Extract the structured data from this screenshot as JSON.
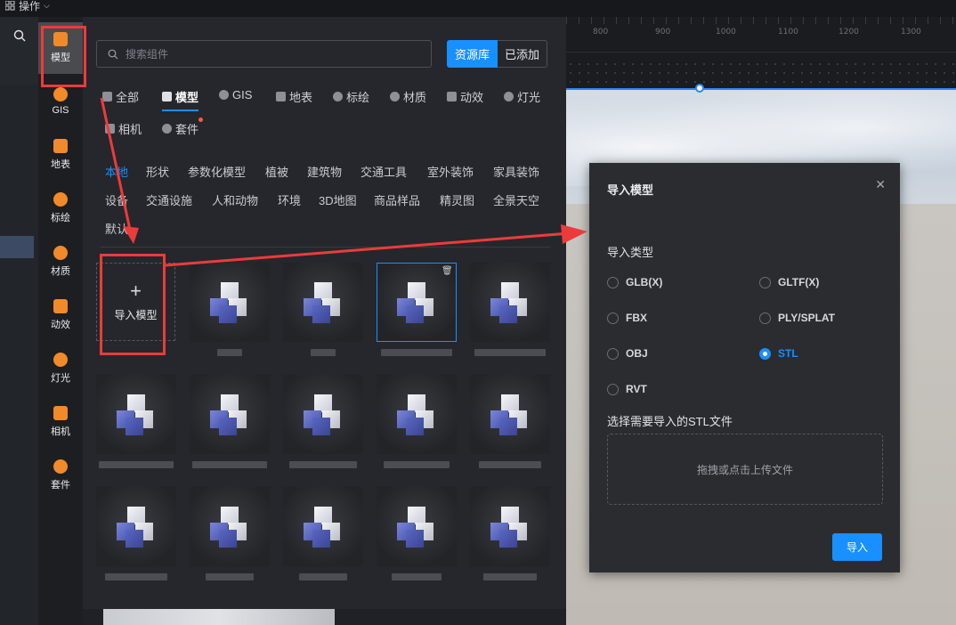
{
  "topbar": {
    "menu_label": "操作"
  },
  "ruler": {
    "ticks": [
      "800",
      "900",
      "1000",
      "1100",
      "1200",
      "1300"
    ]
  },
  "nav": {
    "items": [
      {
        "label": "模型",
        "icon": "model-icon"
      },
      {
        "label": "GIS",
        "icon": "gis-icon"
      },
      {
        "label": "地表",
        "icon": "terrain-icon"
      },
      {
        "label": "标绘",
        "icon": "pin-icon"
      },
      {
        "label": "材质",
        "icon": "material-icon"
      },
      {
        "label": "动效",
        "icon": "effect-icon"
      },
      {
        "label": "灯光",
        "icon": "light-icon"
      },
      {
        "label": "相机",
        "icon": "camera-icon"
      },
      {
        "label": "套件",
        "icon": "kit-icon"
      }
    ]
  },
  "panel": {
    "search_placeholder": "搜索组件",
    "source_tabs": [
      "资源库",
      "已添加"
    ],
    "tabs": [
      "全部",
      "模型",
      "GIS",
      "地表",
      "标绘",
      "材质",
      "动效",
      "灯光",
      "相机",
      "套件"
    ],
    "categories": [
      "本地",
      "形状",
      "参数化模型",
      "植被",
      "建筑物",
      "交通工具",
      "室外装饰",
      "家具装饰",
      "设备",
      "交通设施",
      "人和动物",
      "环境",
      "3D地图",
      "商品样品",
      "精灵图",
      "全景天空",
      "默认"
    ],
    "add_label": "导入模型"
  },
  "dialog": {
    "title": "导入模型",
    "type_label": "导入类型",
    "options": [
      "GLB(X)",
      "GLTF(X)",
      "FBX",
      "PLY/SPLAT",
      "OBJ",
      "STL",
      "RVT"
    ],
    "selected": "STL",
    "file_label": "选择需要导入的STL文件",
    "dropzone_text": "拖拽或点击上传文件",
    "submit_label": "导入"
  },
  "colors": {
    "accent": "#1890ff",
    "highlight": "#ec3b3b",
    "nav_icon": "#f08a2a"
  }
}
